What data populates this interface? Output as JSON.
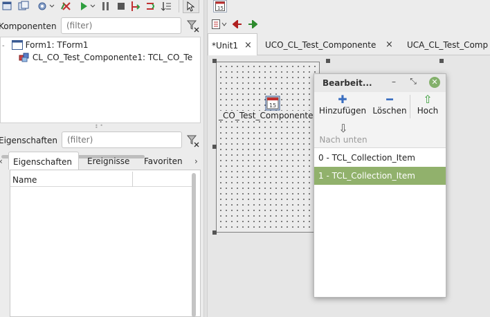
{
  "components_panel": {
    "label": "Komponenten",
    "filter_placeholder": "(filter)",
    "tree": [
      {
        "text": "Form1: TForm1"
      },
      {
        "text": "CL_CO_Test_Componente1: TCL_CO_Te"
      }
    ]
  },
  "properties_panel": {
    "label": "Eigenschaften",
    "filter_placeholder": "(filter)",
    "tabs": [
      "Eigenschaften",
      "Ereignisse",
      "Favoriten"
    ],
    "grid_column": "Name"
  },
  "editor": {
    "tabs": [
      {
        "label": "*Unit1"
      },
      {
        "label": "UCO_CL_Test_Componente"
      },
      {
        "label": "UCA_CL_Test_Comp"
      }
    ],
    "component_caption": "_CO_Test_Componente1"
  },
  "dialog": {
    "title": "Bearbeit...",
    "tools": {
      "add": "Hinzufügen",
      "delete": "Löschen",
      "up": "Hoch",
      "down": "Nach unten"
    },
    "items": [
      "0 - TCL_Collection_Item",
      "1 - TCL_Collection_Item"
    ]
  }
}
